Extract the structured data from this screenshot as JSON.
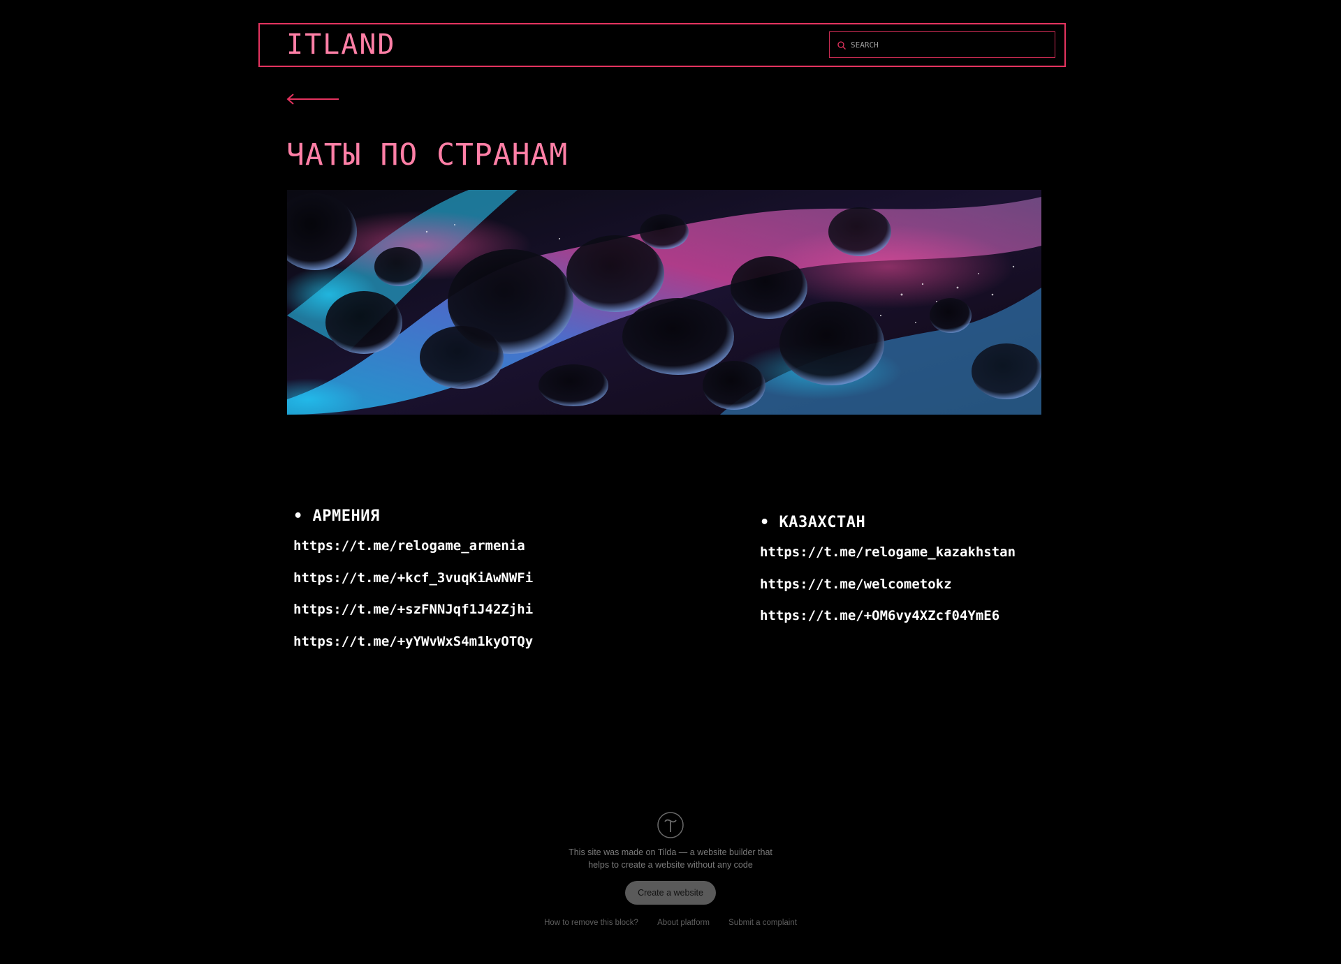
{
  "header": {
    "logo": "ITLAND",
    "search_placeholder": "SEARCH"
  },
  "page": {
    "title": "ЧАТЫ ПО СТРАНАМ"
  },
  "colors": {
    "accent": "#e4335f",
    "accent_text": "#ff7fa6",
    "background": "#000000"
  },
  "countries": [
    {
      "heading": "• АРМЕНИЯ",
      "links": [
        "https://t.me/relogame_armenia",
        "https://t.me/+kcf_3vuqKiAwNWFi",
        "https://t.me/+szFNNJqf1J42Zjhi",
        "https://t.me/+yYWvWxS4m1kyOTQy"
      ]
    },
    {
      "heading": "• КАЗАХСТАН",
      "links": [
        "https://t.me/relogame_kazakhstan",
        "https://t.me/welcometokz",
        "https://t.me/+OM6vy4XZcf04YmE6"
      ]
    }
  ],
  "footer": {
    "text": "This site was made on Tilda — a website builder that helps to create a website without any code",
    "create_button": "Create a website",
    "links": [
      "How to remove this block?",
      "About platform",
      "Submit a complaint"
    ]
  }
}
